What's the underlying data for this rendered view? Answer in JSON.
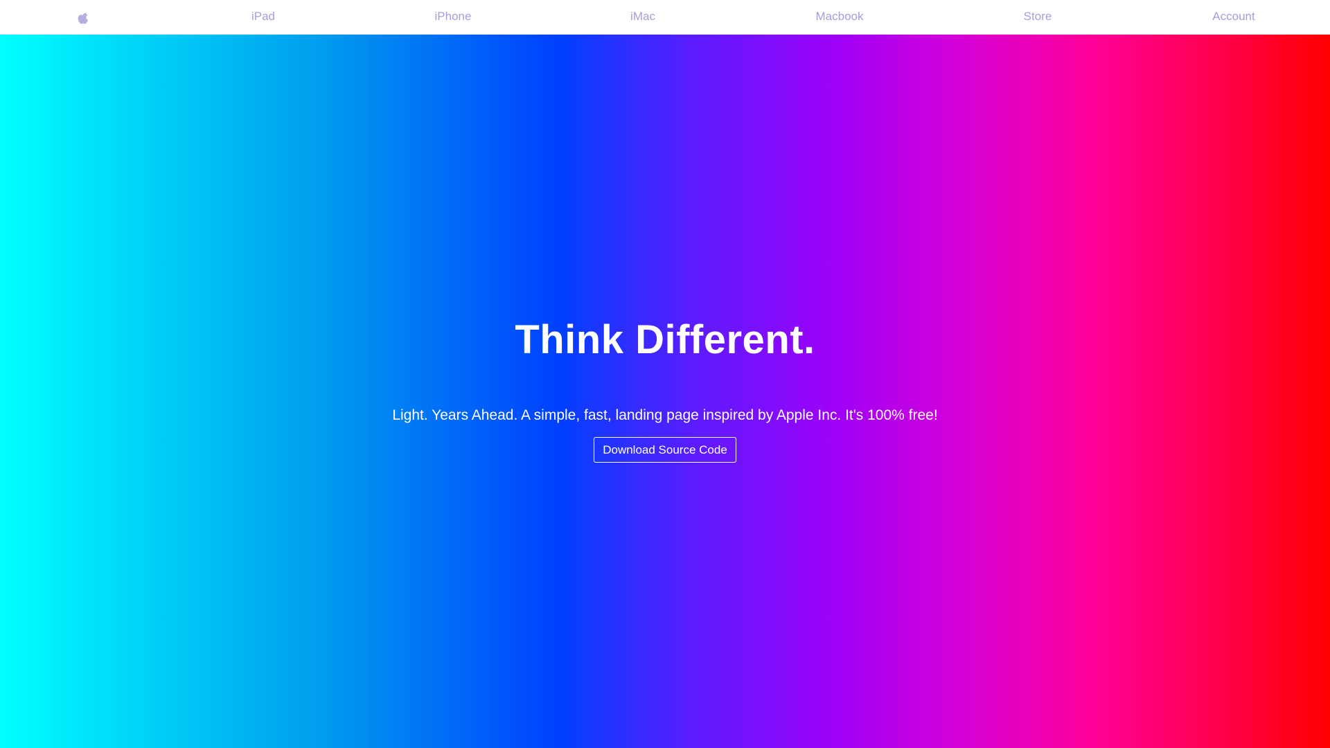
{
  "nav": {
    "logo_icon": "apple-logo-icon",
    "links": [
      {
        "label": "iPad"
      },
      {
        "label": "iPhone"
      },
      {
        "label": "iMac"
      },
      {
        "label": "Macbook"
      },
      {
        "label": "Store"
      },
      {
        "label": "Account"
      }
    ]
  },
  "hero": {
    "title": "Think Different.",
    "subtitle": "Light. Years Ahead. A simple, fast, landing page inspired by Apple Inc. It's 100% free!",
    "button_label": "Download Source Code"
  },
  "colors": {
    "nav_link": "#a79cde",
    "gradient": [
      "#00ffff",
      "#0040ff",
      "#a000f8",
      "#ff009a",
      "#ff0000"
    ]
  }
}
